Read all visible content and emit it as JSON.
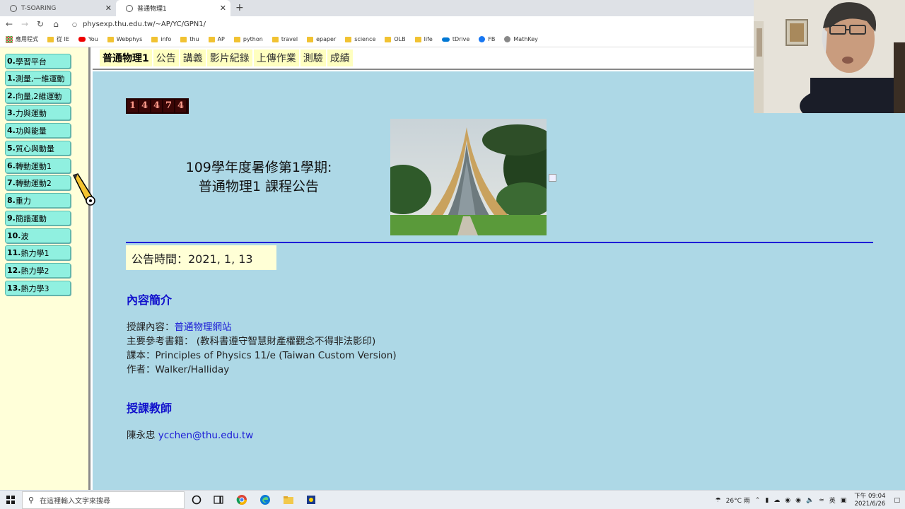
{
  "browser": {
    "tabs": [
      {
        "title": "T-SOARING",
        "close": "✕"
      },
      {
        "title": "普通物理1",
        "close": "✕"
      }
    ],
    "new_tab": "+",
    "nav": {
      "back": "←",
      "forward": "→",
      "reload": "↻",
      "home": "⌂"
    },
    "url": "physexp.thu.edu.tw/~AP/YC/GPN1/",
    "bookmarks": [
      {
        "label": "應用程式",
        "icon": "apps-icon"
      },
      {
        "label": "從 IE",
        "icon": "folder-icon"
      },
      {
        "label": "You",
        "icon": "youtube-icon"
      },
      {
        "label": "Webphys",
        "icon": "folder-icon"
      },
      {
        "label": "info",
        "icon": "folder-icon"
      },
      {
        "label": "thu",
        "icon": "folder-icon"
      },
      {
        "label": "AP",
        "icon": "folder-icon"
      },
      {
        "label": "python",
        "icon": "folder-icon"
      },
      {
        "label": "travel",
        "icon": "folder-icon"
      },
      {
        "label": "epaper",
        "icon": "folder-icon"
      },
      {
        "label": "science",
        "icon": "folder-icon"
      },
      {
        "label": "OLB",
        "icon": "folder-icon"
      },
      {
        "label": "life",
        "icon": "folder-icon"
      },
      {
        "label": "tDrive",
        "icon": "cloud-icon"
      },
      {
        "label": "FB",
        "icon": "facebook-icon"
      },
      {
        "label": "MathKey",
        "icon": "mathkey-icon"
      }
    ]
  },
  "sidebar": {
    "chapters": [
      {
        "num": "0.",
        "label": "學習平台"
      },
      {
        "num": "1.",
        "label": "測量,一維運動"
      },
      {
        "num": "2.",
        "label": "向量,2維運動"
      },
      {
        "num": "3.",
        "label": "力與運動"
      },
      {
        "num": "4.",
        "label": "功與能量"
      },
      {
        "num": "5.",
        "label": "質心與動量"
      },
      {
        "num": "6.",
        "label": "轉動運動1"
      },
      {
        "num": "7.",
        "label": "轉動運動2"
      },
      {
        "num": "8.",
        "label": "重力"
      },
      {
        "num": "9.",
        "label": "簡諧運動"
      },
      {
        "num": "10.",
        "label": "波"
      },
      {
        "num": "11.",
        "label": "熱力學1"
      },
      {
        "num": "12.",
        "label": "熱力學2"
      },
      {
        "num": "13.",
        "label": "熱力學3"
      }
    ]
  },
  "topnav": {
    "items": [
      "普通物理1",
      "公告",
      "講義",
      "影片紀錄",
      "上傳作業",
      "測驗",
      "成績"
    ]
  },
  "main": {
    "counter_digits": [
      "1",
      "4",
      "4",
      "7",
      "4"
    ],
    "headline_line1": "109學年度暑修第1學期:",
    "headline_line2": "普通物理1 課程公告",
    "notice_time": "公告時間：2021, 1, 13",
    "intro_title": "內容簡介",
    "course_content_label": "授課內容：",
    "course_content_link": "普通物理網站",
    "reference_line": "主要參考書籍： (教科書遵守智慧財產權觀念不得非法影印)",
    "textbook_line": "課本：Principles of Physics 11/e (Taiwan Custom Version)",
    "author_line": "作者：Walker/Halliday",
    "teacher_title": "授課教師",
    "teacher_name": "陳永忠 ",
    "teacher_email": "ycchen@thu.edu.tw"
  },
  "taskbar": {
    "search_placeholder": "在這裡輸入文字來搜尋",
    "weather": "26°C 雨",
    "ime": "英",
    "time": "下午 09:04",
    "date": "2021/6/26"
  },
  "colors": {
    "main_bg": "#add8e6",
    "sidebar_bg": "#ffffd9",
    "chapter_btn": "#90f0e0",
    "link": "#1a1ad6",
    "divider": "#1d1dd8"
  }
}
